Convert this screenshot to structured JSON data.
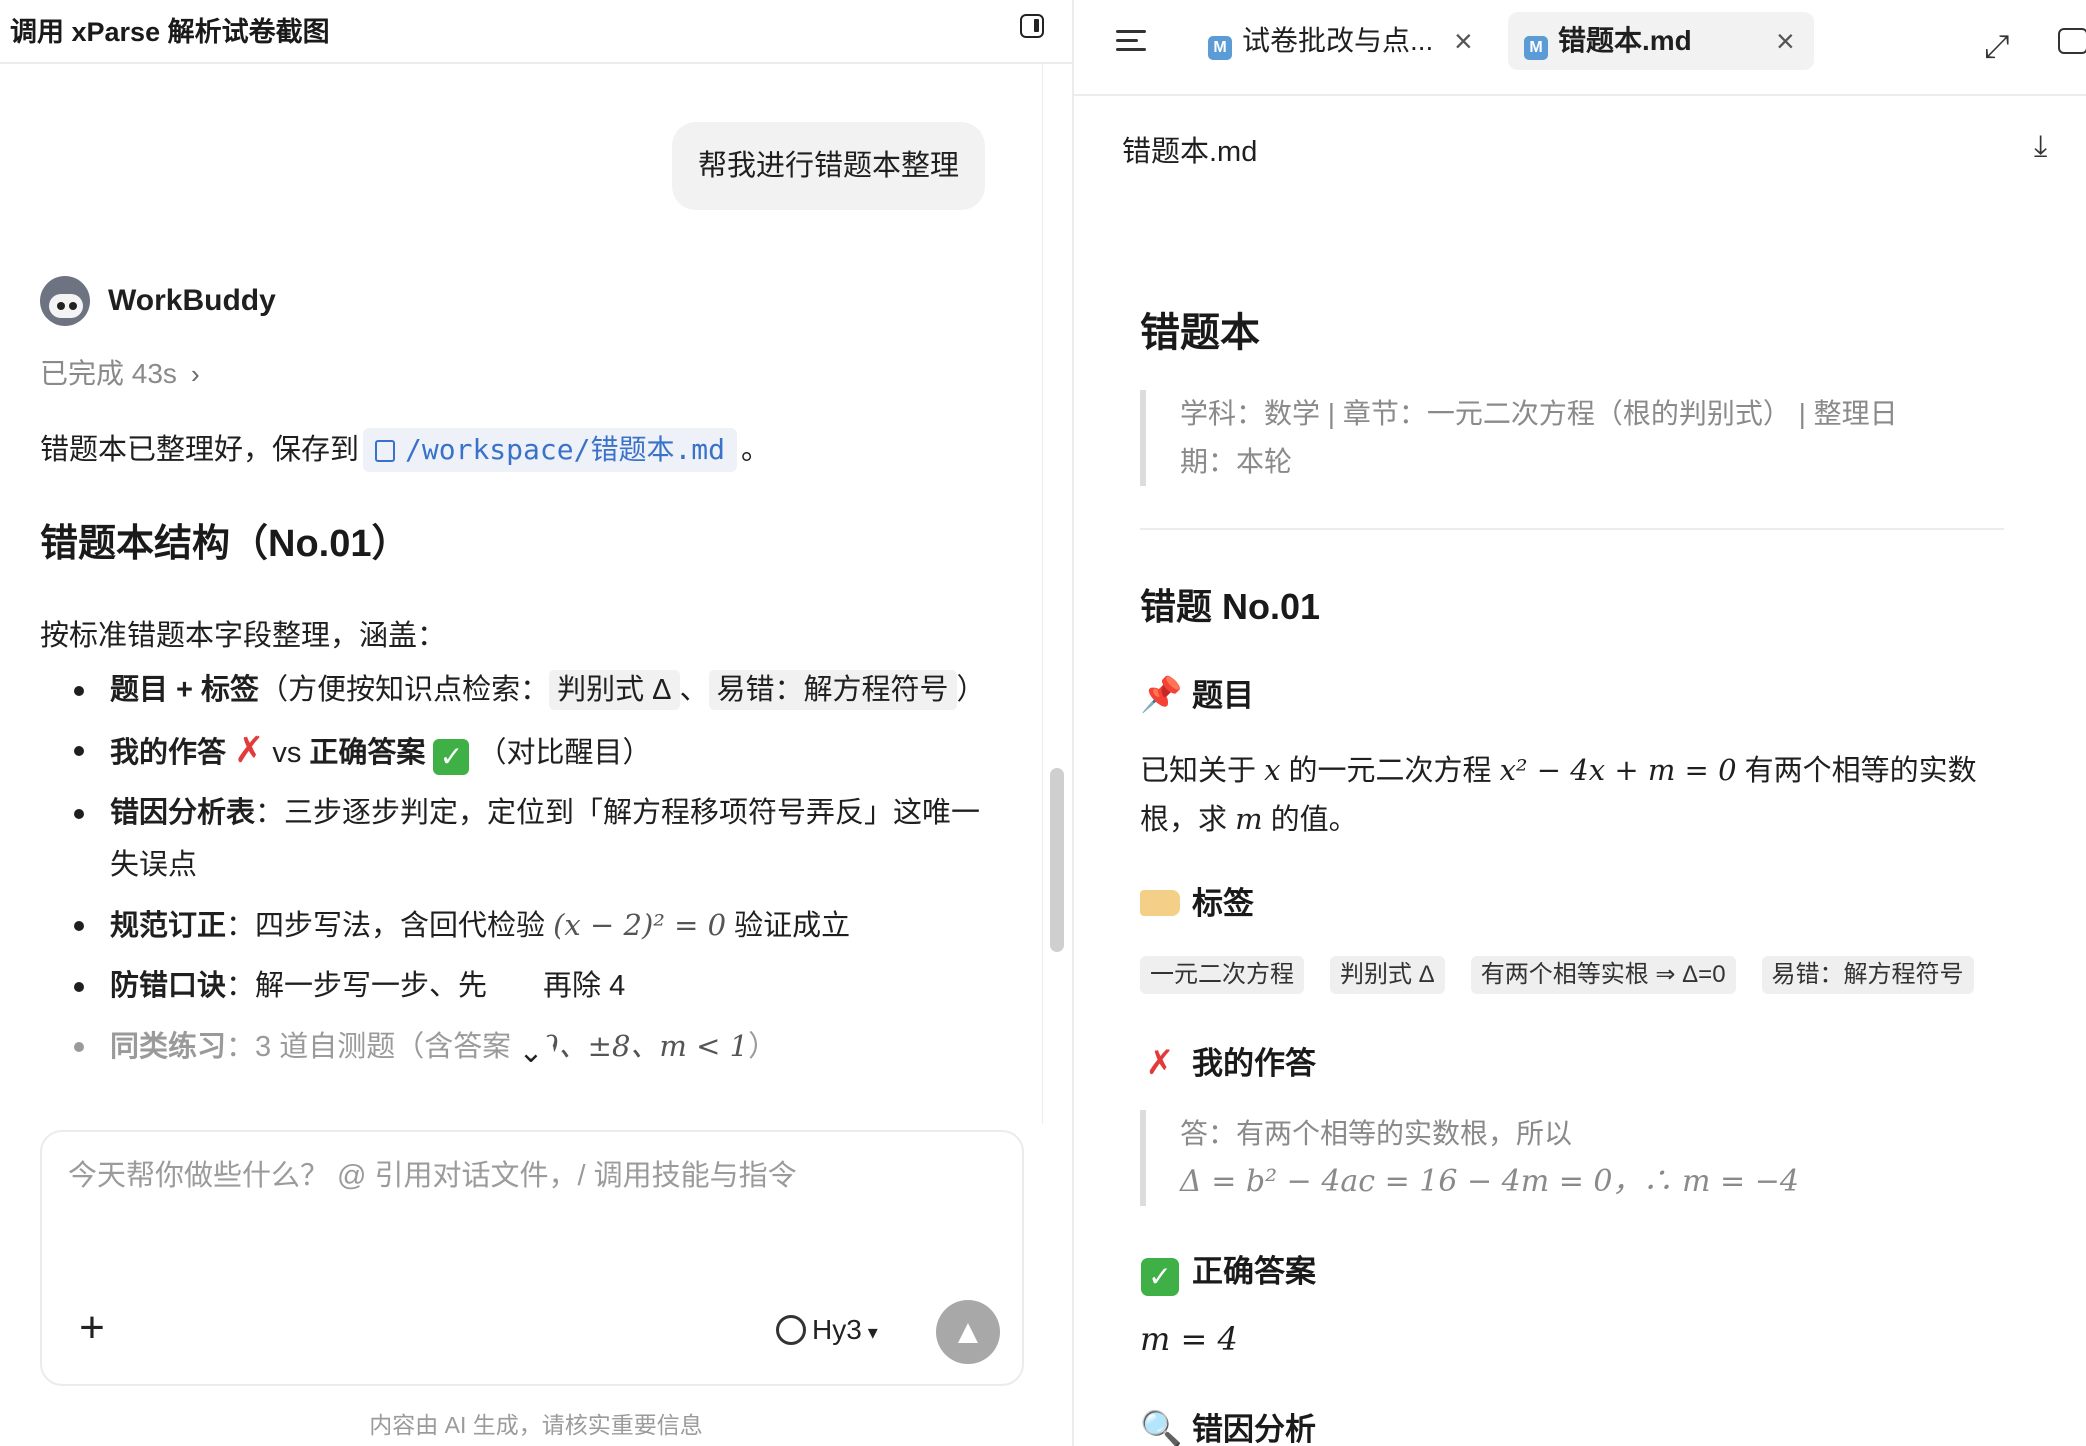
{
  "chat": {
    "title": "调用 xParse 解析试卷截图",
    "user_message": "帮我进行错题本整理",
    "agent": {
      "name": "WorkBuddy",
      "status": "已完成 43s",
      "saved_prefix": "错题本已整理好，保存到",
      "saved_path": "/workspace/错题本.md",
      "saved_suffix": "。",
      "section_title": "错题本结构（No.01）",
      "intro": "按标准错题本字段整理，涵盖：",
      "bullets": [
        {
          "bold": "题目 + 标签",
          "rest": "（方便按知识点检索：",
          "code1": "判别式 Δ",
          "sep": "、",
          "code2": "易错：解方程符号",
          "end": "）"
        },
        {
          "bold1": "我的作答",
          "mid": "vs",
          "bold2": "正确答案",
          "end": "（对比醒目）"
        },
        {
          "bold": "错因分析表",
          "rest": "：三步逐步判定，定位到「解方程移项符号弄反」这唯一失误点"
        },
        {
          "bold": "规范订正",
          "rest": "：四步写法，含回代检验",
          "math": "(x − 2)² = 0",
          "end": "验证成立"
        },
        {
          "bold": "防错口诀",
          "rest": "：解一步写一步、先",
          "end": "再除 4"
        },
        {
          "bold": "同类练习",
          "rest": "：3 道自测题（含答案：",
          "math": "9、±8、m < 1",
          "end": "）"
        }
      ]
    },
    "composer": {
      "placeholder": "今天帮你做些什么？ @ 引用对话文件，/ 调用技能与指令",
      "model": "Hy3"
    },
    "disclaimer": "内容由 AI 生成，请核实重要信息"
  },
  "doc": {
    "tabs": [
      {
        "label": "试卷批改与点...",
        "icon": "M"
      },
      {
        "label": "错题本.md",
        "icon": "M"
      }
    ],
    "filename": "错题本.md",
    "h1": "错题本",
    "meta": "学科：数学 | 章节：一元二次方程（根的判别式） | 整理日期：本轮",
    "h2": "错题 No.01",
    "sections": {
      "problem": "题目",
      "tags": "标签",
      "mine": "我的作答",
      "correct": "正确答案",
      "analysis": "错因分析"
    },
    "problem": {
      "p1": "已知关于",
      "v1": "x",
      "p2": "的一元二次方程",
      "eq": "x² − 4x + m = 0",
      "p3": "有两个相等的实数根，求",
      "v2": "m",
      "p4": "的值。"
    },
    "tags": [
      "一元二次方程",
      "判别式 Δ",
      "有两个相等实根 ⇒ Δ=0",
      "易错：解方程符号"
    ],
    "mine": {
      "line1": "答：有两个相等的实数根，所以",
      "line2": "Δ = b² − 4ac = 16 − 4m = 0，∴ m = −4"
    },
    "correct": "m = 4"
  }
}
